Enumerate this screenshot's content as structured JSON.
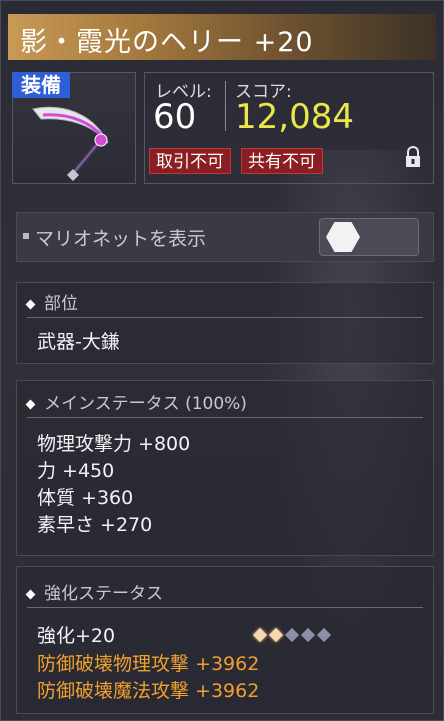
{
  "item": {
    "title": "影・霞光のヘリー +20",
    "equip_badge": "装備",
    "level_label": "レベル:",
    "level_value": "60",
    "score_label": "スコア:",
    "score_value": "12,084",
    "tags": [
      "取引不可",
      "共有不可"
    ]
  },
  "marionette": {
    "label": "マリオネットを表示"
  },
  "part": {
    "header": "部位",
    "value": "武器-大鎌"
  },
  "main_status": {
    "header": "メインステータス (100%)",
    "lines": [
      "物理攻撃力 +800",
      "力 +450",
      "体質 +360",
      "素早さ +270"
    ]
  },
  "enhance": {
    "header": "強化ステータス",
    "level_text": "強化+20",
    "stars_filled": 2,
    "stars_total": 5,
    "bonus_lines": [
      "防御破壊物理攻撃 +3962",
      "防御破壊魔法攻撃 +3962"
    ]
  },
  "colors": {
    "score": "#e9e74b",
    "bonus_orange": "#f0a02e",
    "tag_red": "#8b1e22",
    "badge_blue": "#2f5fd6"
  }
}
